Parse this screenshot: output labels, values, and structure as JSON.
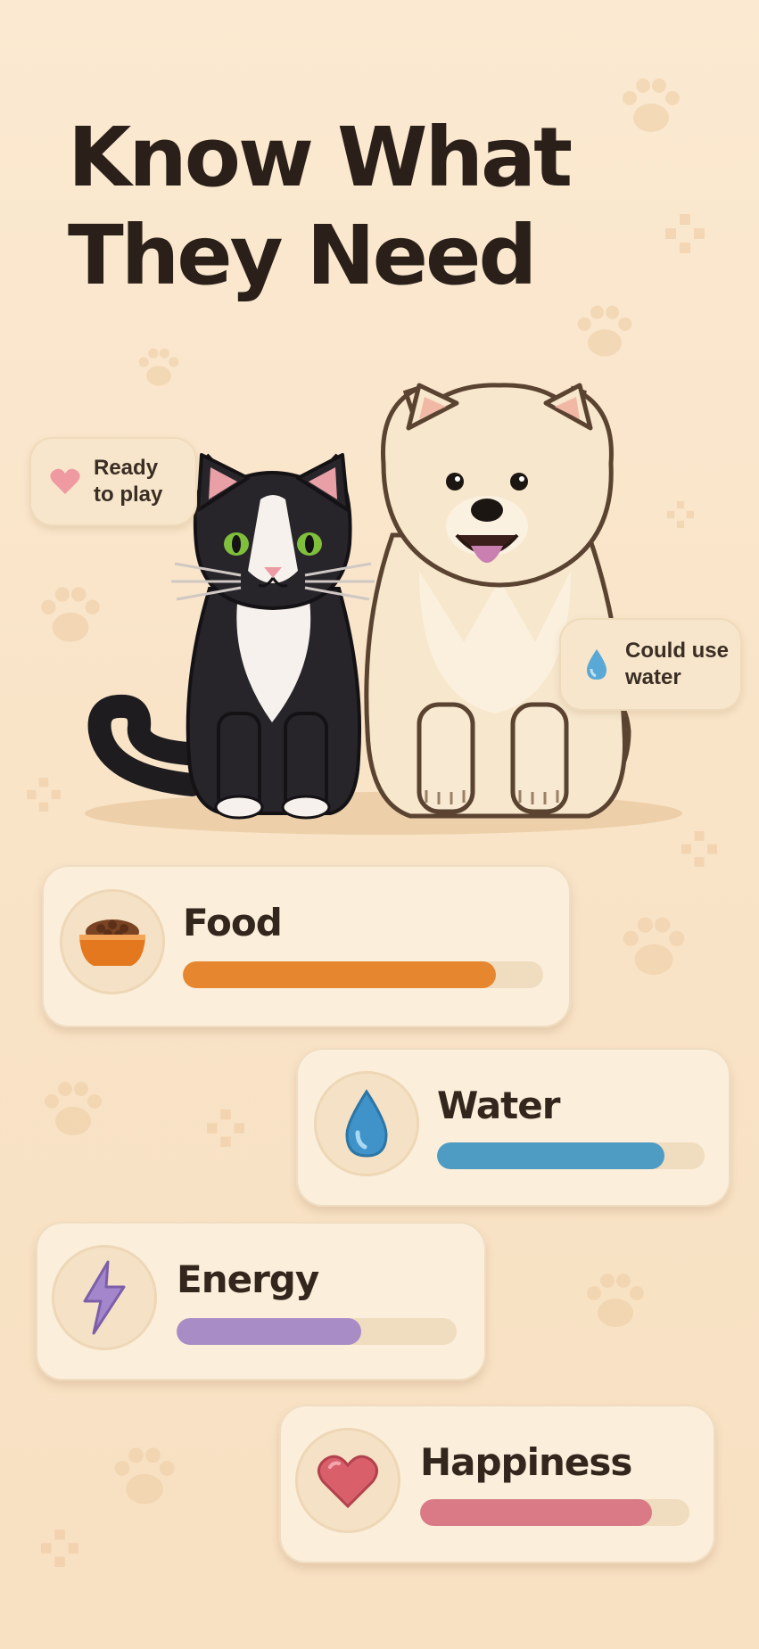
{
  "headline": {
    "line1": "Know What",
    "line2": "They Need"
  },
  "bubbles": [
    {
      "text": "Ready\nto play",
      "icon": "heart-icon"
    },
    {
      "text": "Could use\nwater",
      "icon": "droplet-icon"
    }
  ],
  "stats": [
    {
      "label": "Food",
      "icon": "food-bowl-icon",
      "level": 0.87,
      "color": "#e6862e"
    },
    {
      "label": "Water",
      "icon": "droplet-icon",
      "level": 0.85,
      "color": "#4e9cc4"
    },
    {
      "label": "Energy",
      "icon": "lightning-icon",
      "level": 0.66,
      "color": "#a88cc6"
    },
    {
      "label": "Happiness",
      "icon": "heart-icon",
      "level": 0.86,
      "color": "#d97a86"
    }
  ],
  "colors": {
    "background": "#fbe9d1",
    "card": "#fbeedb",
    "track": "#f0dcbf"
  }
}
